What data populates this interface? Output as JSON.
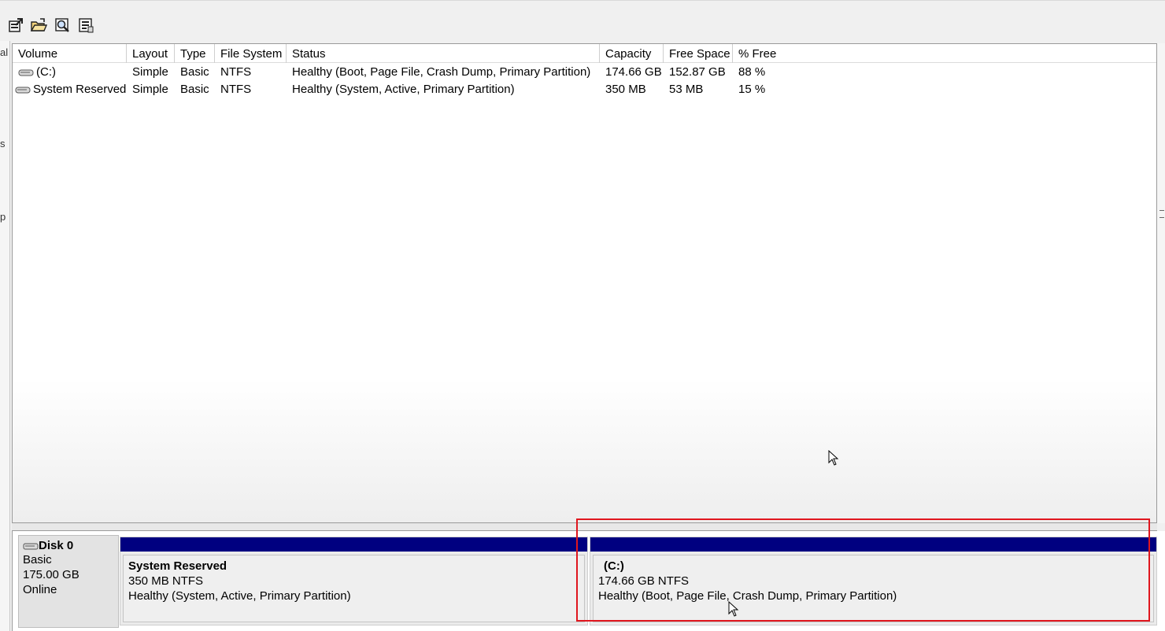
{
  "toolbar": {
    "buttons": [
      {
        "icon": "properties-icon"
      },
      {
        "icon": "open-folder-icon"
      },
      {
        "icon": "rescan-icon"
      },
      {
        "icon": "help-topics-icon"
      }
    ]
  },
  "left_edge": {
    "fragments": [
      "al",
      "s",
      "p"
    ]
  },
  "volume_list": {
    "columns": [
      "Volume",
      "Layout",
      "Type",
      "File System",
      "Status",
      "Capacity",
      "Free Space",
      "% Free"
    ],
    "rows": [
      {
        "volume": "(C:)",
        "layout": "Simple",
        "type": "Basic",
        "fs": "NTFS",
        "status": "Healthy (Boot, Page File, Crash Dump, Primary Partition)",
        "capacity": "174.66 GB",
        "free": "152.87 GB",
        "pct": "88 %"
      },
      {
        "volume": "System Reserved",
        "layout": "Simple",
        "type": "Basic",
        "fs": "NTFS",
        "status": "Healthy (System, Active, Primary Partition)",
        "capacity": "350 MB",
        "free": "53 MB",
        "pct": "15 %"
      }
    ]
  },
  "disk": {
    "name": "Disk 0",
    "type": "Basic",
    "size": "175.00 GB",
    "state": "Online",
    "partitions": [
      {
        "name": "System Reserved",
        "size_fs": "350 MB NTFS",
        "status": "Healthy (System, Active, Primary Partition)"
      },
      {
        "name": "(C:)",
        "size_fs": "174.66 GB NTFS",
        "status": "Healthy (Boot, Page File, Crash Dump, Primary Partition)"
      }
    ]
  },
  "colors": {
    "partition_bar": "#000080",
    "highlight": "#e0161e"
  }
}
